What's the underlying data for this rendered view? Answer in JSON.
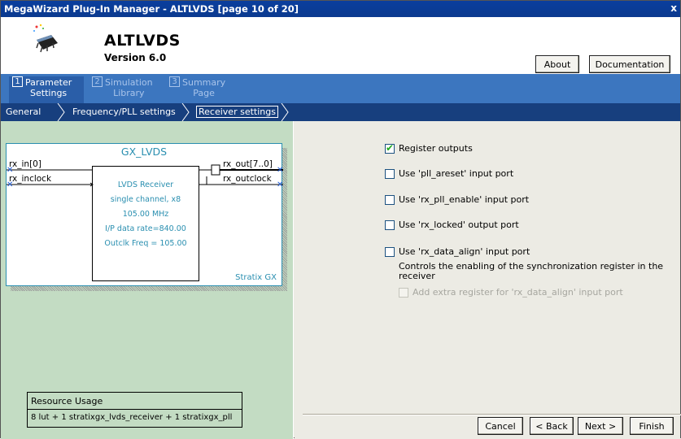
{
  "window": {
    "title": "MegaWizard Plug-In Manager - ALTLVDS [page 10 of 20]",
    "close": "x"
  },
  "header": {
    "component": "ALTLVDS",
    "version": "Version 6.0",
    "about": "About",
    "documentation": "Documentation"
  },
  "steps": [
    {
      "num": "1",
      "label": "Parameter\nSettings",
      "active": true
    },
    {
      "num": "2",
      "label": "Simulation\nLibrary",
      "active": false
    },
    {
      "num": "3",
      "label": "Summary\nPage",
      "active": false
    }
  ],
  "subtabs": [
    "General",
    "Frequency/PLL settings",
    "Receiver settings"
  ],
  "diagram": {
    "title": "GX_LVDS",
    "ports_in": [
      "rx_in[0]",
      "rx_inclock"
    ],
    "ports_out": [
      "rx_out[7..0]",
      "rx_outclock"
    ],
    "box_lines": [
      "LVDS Receiver",
      "single channel, x8",
      "105.00 MHz",
      "I/P data rate=840.00",
      "Outclk Freq = 105.00"
    ],
    "family": "Stratix GX"
  },
  "resource": {
    "title": "Resource Usage",
    "value": "8 lut + 1 stratixgx_lvds_receiver + 1 stratixgx_pll"
  },
  "options": [
    {
      "label": "Register outputs",
      "checked": true,
      "disabled": false
    },
    {
      "label": "Use 'pll_areset' input port",
      "checked": false,
      "disabled": false
    },
    {
      "label": "Use 'rx_pll_enable' input port",
      "checked": false,
      "disabled": false
    },
    {
      "label": "Use 'rx_locked' output port",
      "checked": false,
      "disabled": false
    },
    {
      "label": "Use 'rx_data_align' input port",
      "checked": false,
      "disabled": false
    }
  ],
  "description": "Controls the enabling of the synchronization register in the receiver",
  "sub_option": {
    "label": "Add extra register for 'rx_data_align' input port",
    "checked": false,
    "disabled": true
  },
  "footer": {
    "cancel": "Cancel",
    "back": "< Back",
    "next": "Next >",
    "finish": "Finish"
  }
}
